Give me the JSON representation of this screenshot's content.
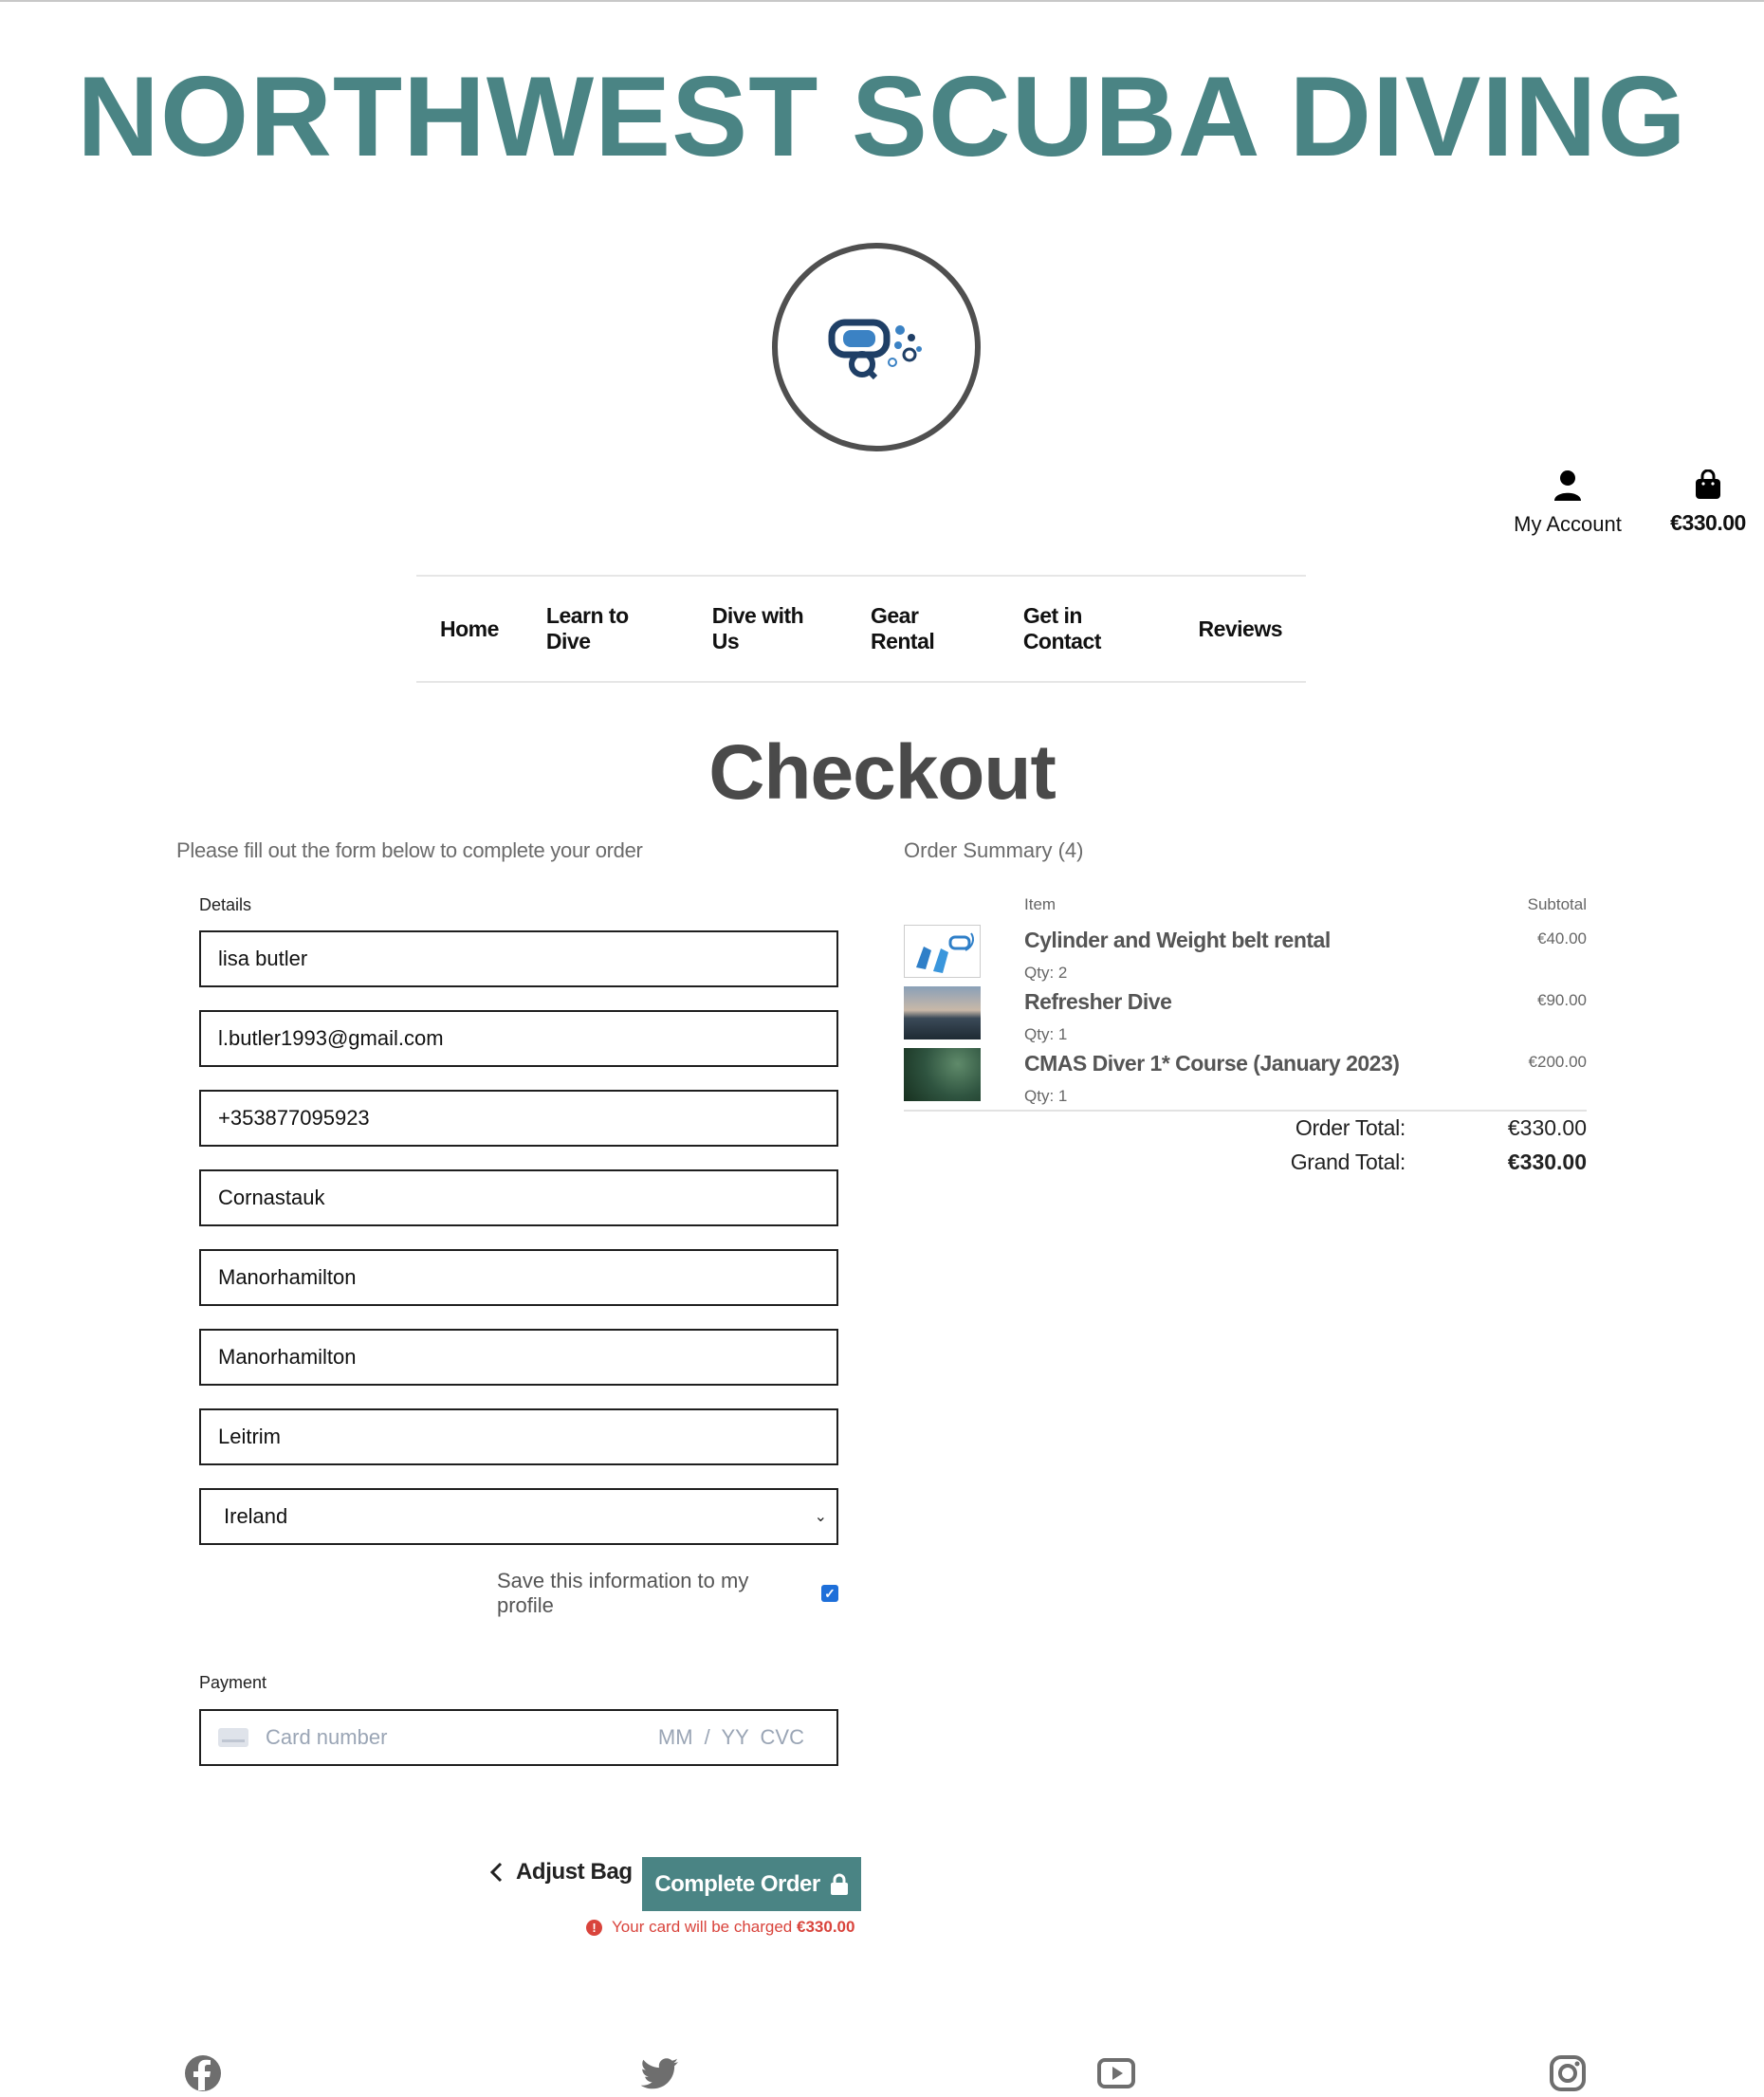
{
  "brand": {
    "name": "NORTHWEST SCUBA DIVING"
  },
  "header": {
    "account_label": "My Account",
    "bag_total": "€330.00"
  },
  "nav": {
    "items": [
      "Home",
      "Learn to Dive",
      "Dive with Us",
      "Gear Rental",
      "Get in Contact",
      "Reviews"
    ]
  },
  "page": {
    "title": "Checkout",
    "form_intro": "Please fill out the form below to complete your order"
  },
  "details": {
    "label": "Details",
    "full_name": "lisa butler",
    "email": "l.butler1993@gmail.com",
    "phone": "+353877095923",
    "street1": "Cornastauk",
    "street2": "Manorhamilton",
    "town": "Manorhamilton",
    "county": "Leitrim",
    "country": "Ireland",
    "save_info_label": "Save this information to my profile",
    "save_info_checked": true
  },
  "payment": {
    "label": "Payment",
    "card_placeholder": "Card number",
    "expiry_cvc_placeholder": "MM / YY  CVC"
  },
  "actions": {
    "adjust_bag": "Adjust Bag",
    "complete_order": "Complete Order",
    "charge_prefix": "Your card will be charged",
    "charge_amount": "€330.00"
  },
  "summary": {
    "title": "Order Summary (4)",
    "col_item": "Item",
    "col_subtotal": "Subtotal",
    "items": [
      {
        "name": "Cylinder and Weight belt rental",
        "qty": "Qty: 2",
        "subtotal": "€40.00",
        "thumb": "fins-mask-icon"
      },
      {
        "name": "Refresher Dive",
        "qty": "Qty: 1",
        "subtotal": "€90.00",
        "thumb": "sunset-divers-photo"
      },
      {
        "name": "CMAS Diver 1* Course (January 2023)",
        "qty": "Qty: 1",
        "subtotal": "€200.00",
        "thumb": "underwater-diver-photo"
      }
    ],
    "order_total_label": "Order Total:",
    "order_total": "€330.00",
    "grand_total_label": "Grand Total:",
    "grand_total": "€330.00"
  },
  "footer": {
    "social_icons": [
      "facebook-icon",
      "twitter-icon",
      "youtube-icon",
      "instagram-icon"
    ]
  },
  "colors": {
    "brand_teal": "#4a8484",
    "error_red": "#d9443c",
    "checkbox_blue": "#1e6fd9"
  }
}
